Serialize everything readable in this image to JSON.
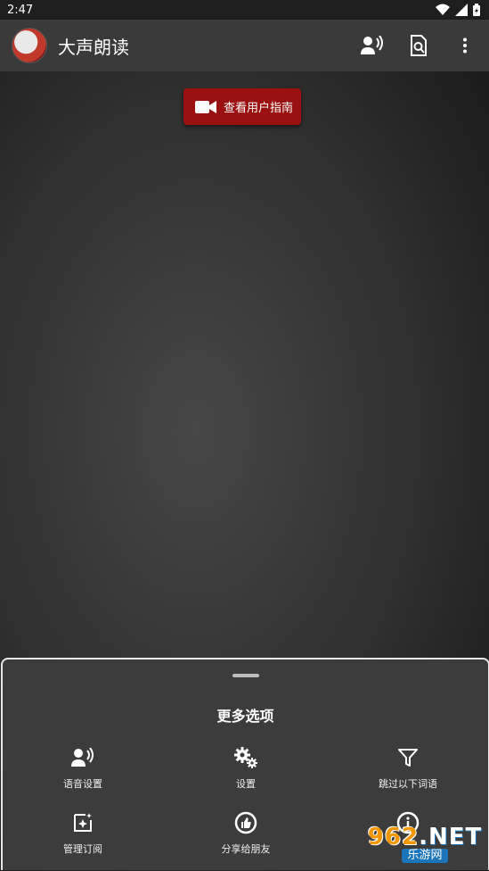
{
  "status_bar": {
    "time": "2:47",
    "icons": [
      "wifi-icon",
      "signal-icon",
      "battery-icon"
    ]
  },
  "app_bar": {
    "title": "大声朗读",
    "actions": [
      "voice-icon",
      "search-page-icon",
      "more-vert-icon"
    ]
  },
  "main": {
    "guide_button": {
      "label": "查看用户指南",
      "icon": "video-camera-icon",
      "color": "#9b1010"
    }
  },
  "sheet": {
    "title": "更多选项",
    "options": [
      {
        "label": "语音设置",
        "icon": "voice-settings-icon"
      },
      {
        "label": "设置",
        "icon": "gears-icon"
      },
      {
        "label": "跳过以下词语",
        "icon": "filter-icon"
      },
      {
        "label": "管理订阅",
        "icon": "subscription-icon"
      },
      {
        "label": "分享给朋友",
        "icon": "thumbs-up-icon"
      },
      {
        "label": "",
        "icon": "info-icon"
      }
    ]
  },
  "watermark": {
    "top": "962",
    "net": ".NET",
    "bottom": "乐游网"
  }
}
